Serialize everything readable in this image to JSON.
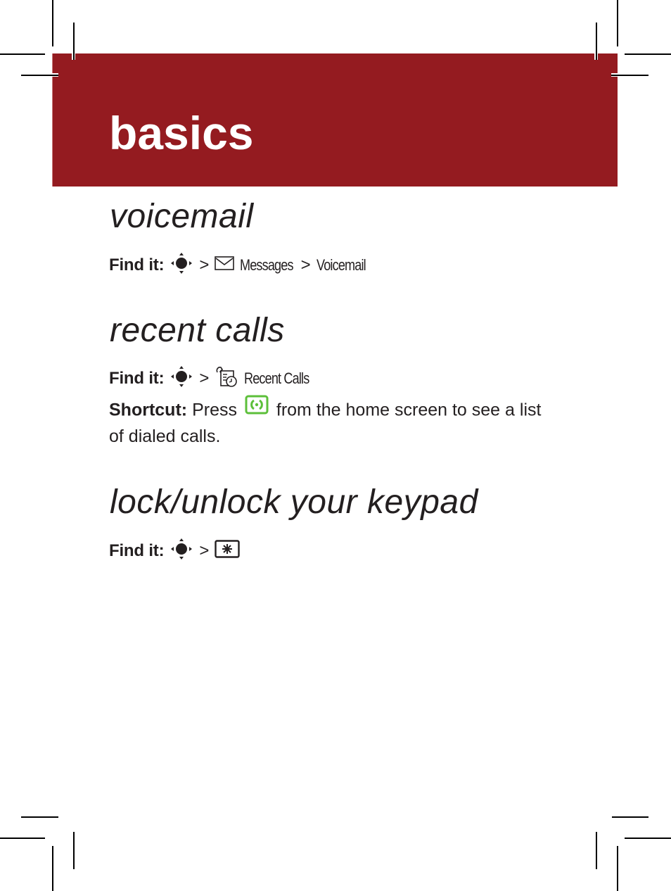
{
  "page": {
    "header": {
      "title": "basics",
      "color": "#941b20"
    },
    "sections": [
      {
        "title": "voicemail",
        "find_it": {
          "label": "Find it:",
          "path": [
            {
              "icon": "nav-key-icon"
            },
            {
              "separator": ">"
            },
            {
              "icon": "envelope-icon",
              "label": "Messages"
            },
            {
              "separator": ">"
            },
            {
              "label": "Voicemail"
            }
          ]
        }
      },
      {
        "title": "recent calls",
        "find_it": {
          "label": "Find it:",
          "path": [
            {
              "icon": "nav-key-icon"
            },
            {
              "separator": ">"
            },
            {
              "icon": "recent-calls-icon",
              "label": "Recent Calls"
            }
          ]
        },
        "shortcut": {
          "label": "Shortcut:",
          "text_before": "Press",
          "icon": "send-key-icon",
          "icon_color": "#5cbf3a",
          "text_after": "from the home screen to see a list",
          "text_line2": "of dialed calls."
        }
      },
      {
        "title": "lock/unlock your keypad",
        "find_it": {
          "label": "Find it:",
          "path": [
            {
              "icon": "nav-key-icon"
            },
            {
              "separator": ">"
            },
            {
              "icon": "star-key-icon"
            }
          ]
        }
      }
    ]
  }
}
